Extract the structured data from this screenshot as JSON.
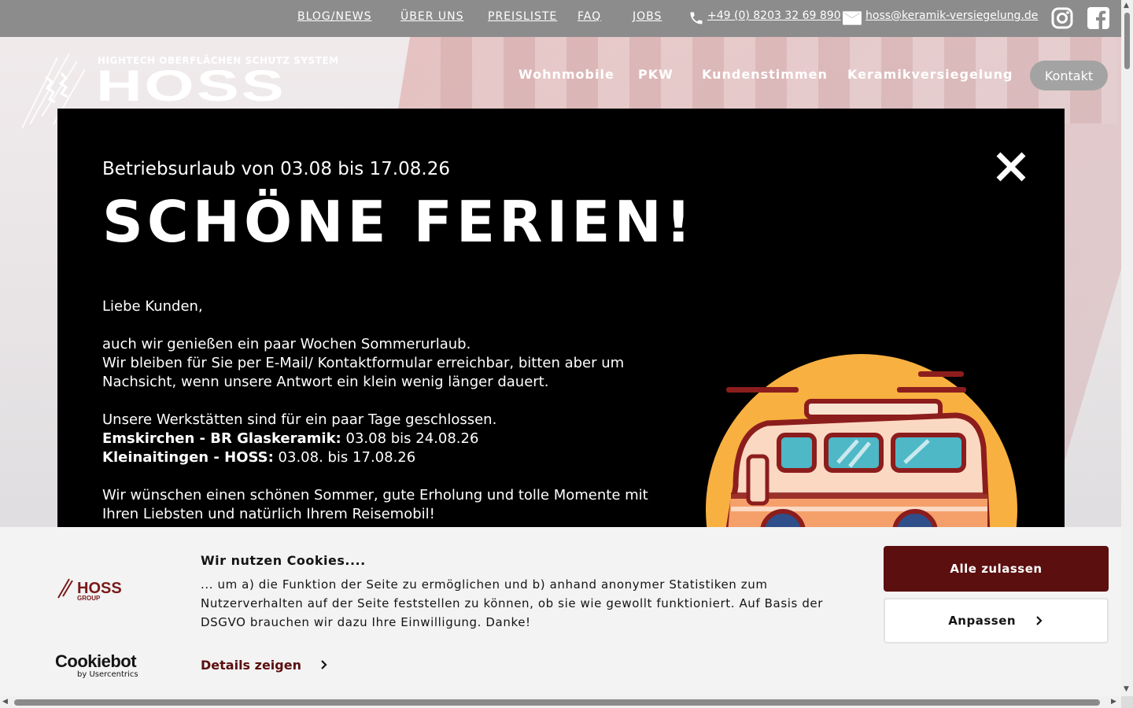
{
  "topbar": {
    "links": [
      "BLOG/NEWS",
      "ÜBER UNS",
      "PREISLISTE",
      "FAQ",
      "JOBS"
    ],
    "phone": "+49 (0) 8203 32 69 890",
    "email": "hoss@keramik-versiegelung.de"
  },
  "header": {
    "logo_tagline": "HIGHTECH OBERFLÄCHEN SCHUTZ SYSTEM",
    "logo_name": "HOSS",
    "nav": [
      "Wohnmobile",
      "PKW",
      "Kundenstimmen",
      "Keramikversiegelung"
    ],
    "contact_button": "Kontakt"
  },
  "modal": {
    "pre_title": "Betriebsurlaub von 03.08 bis 17.08.26",
    "title": "SCHÖNE FERIEN!",
    "greeting": "Liebe Kunden,",
    "para1_line1": "auch wir genießen ein paar Wochen Sommerurlaub.",
    "para1_line2": "Wir bleiben für Sie per E-Mail/ Kontaktformular erreichbar, bitten aber um",
    "para1_line3": "Nachsicht, wenn unsere Antwort ein klein wenig länger dauert.",
    "para2_line1": "Unsere Werkstätten sind für ein paar Tage geschlossen.",
    "loc1_name": "Emskirchen - BR Glaskeramik:",
    "loc1_dates": " 03.08 bis 24.08.26",
    "loc2_name": "Kleinaitingen - HOSS:",
    "loc2_dates": " 03.08. bis 17.08.26",
    "para3_line1": "Wir wünschen einen schönen Sommer, gute Erholung und tolle Momente mit",
    "para3_line2": "Ihren Liebsten und natürlich Ihrem Reisemobil!"
  },
  "cookie": {
    "title": "Wir nutzen Cookies....",
    "text": "... um a) die Funktion der Seite zu ermöglichen und b) anhand anonymer Statistiken zum Nutzerverhalten auf der Seite feststellen zu können, ob sie wie gewollt funktioniert. Auf Basis der DSGVO brauchen wir dazu Ihre Einwilligung. Danke!",
    "details": "Details zeigen",
    "accept": "Alle zulassen",
    "customize": "Anpassen",
    "brand_name": "Cookiebot",
    "brand_sub": "by Usercentrics",
    "logo_name": "HOSS",
    "logo_sub": "GROUP"
  },
  "colors": {
    "topbar": "#8c8c8c",
    "accept_bg": "#5b0f0f",
    "van_sun": "#f8b040"
  }
}
